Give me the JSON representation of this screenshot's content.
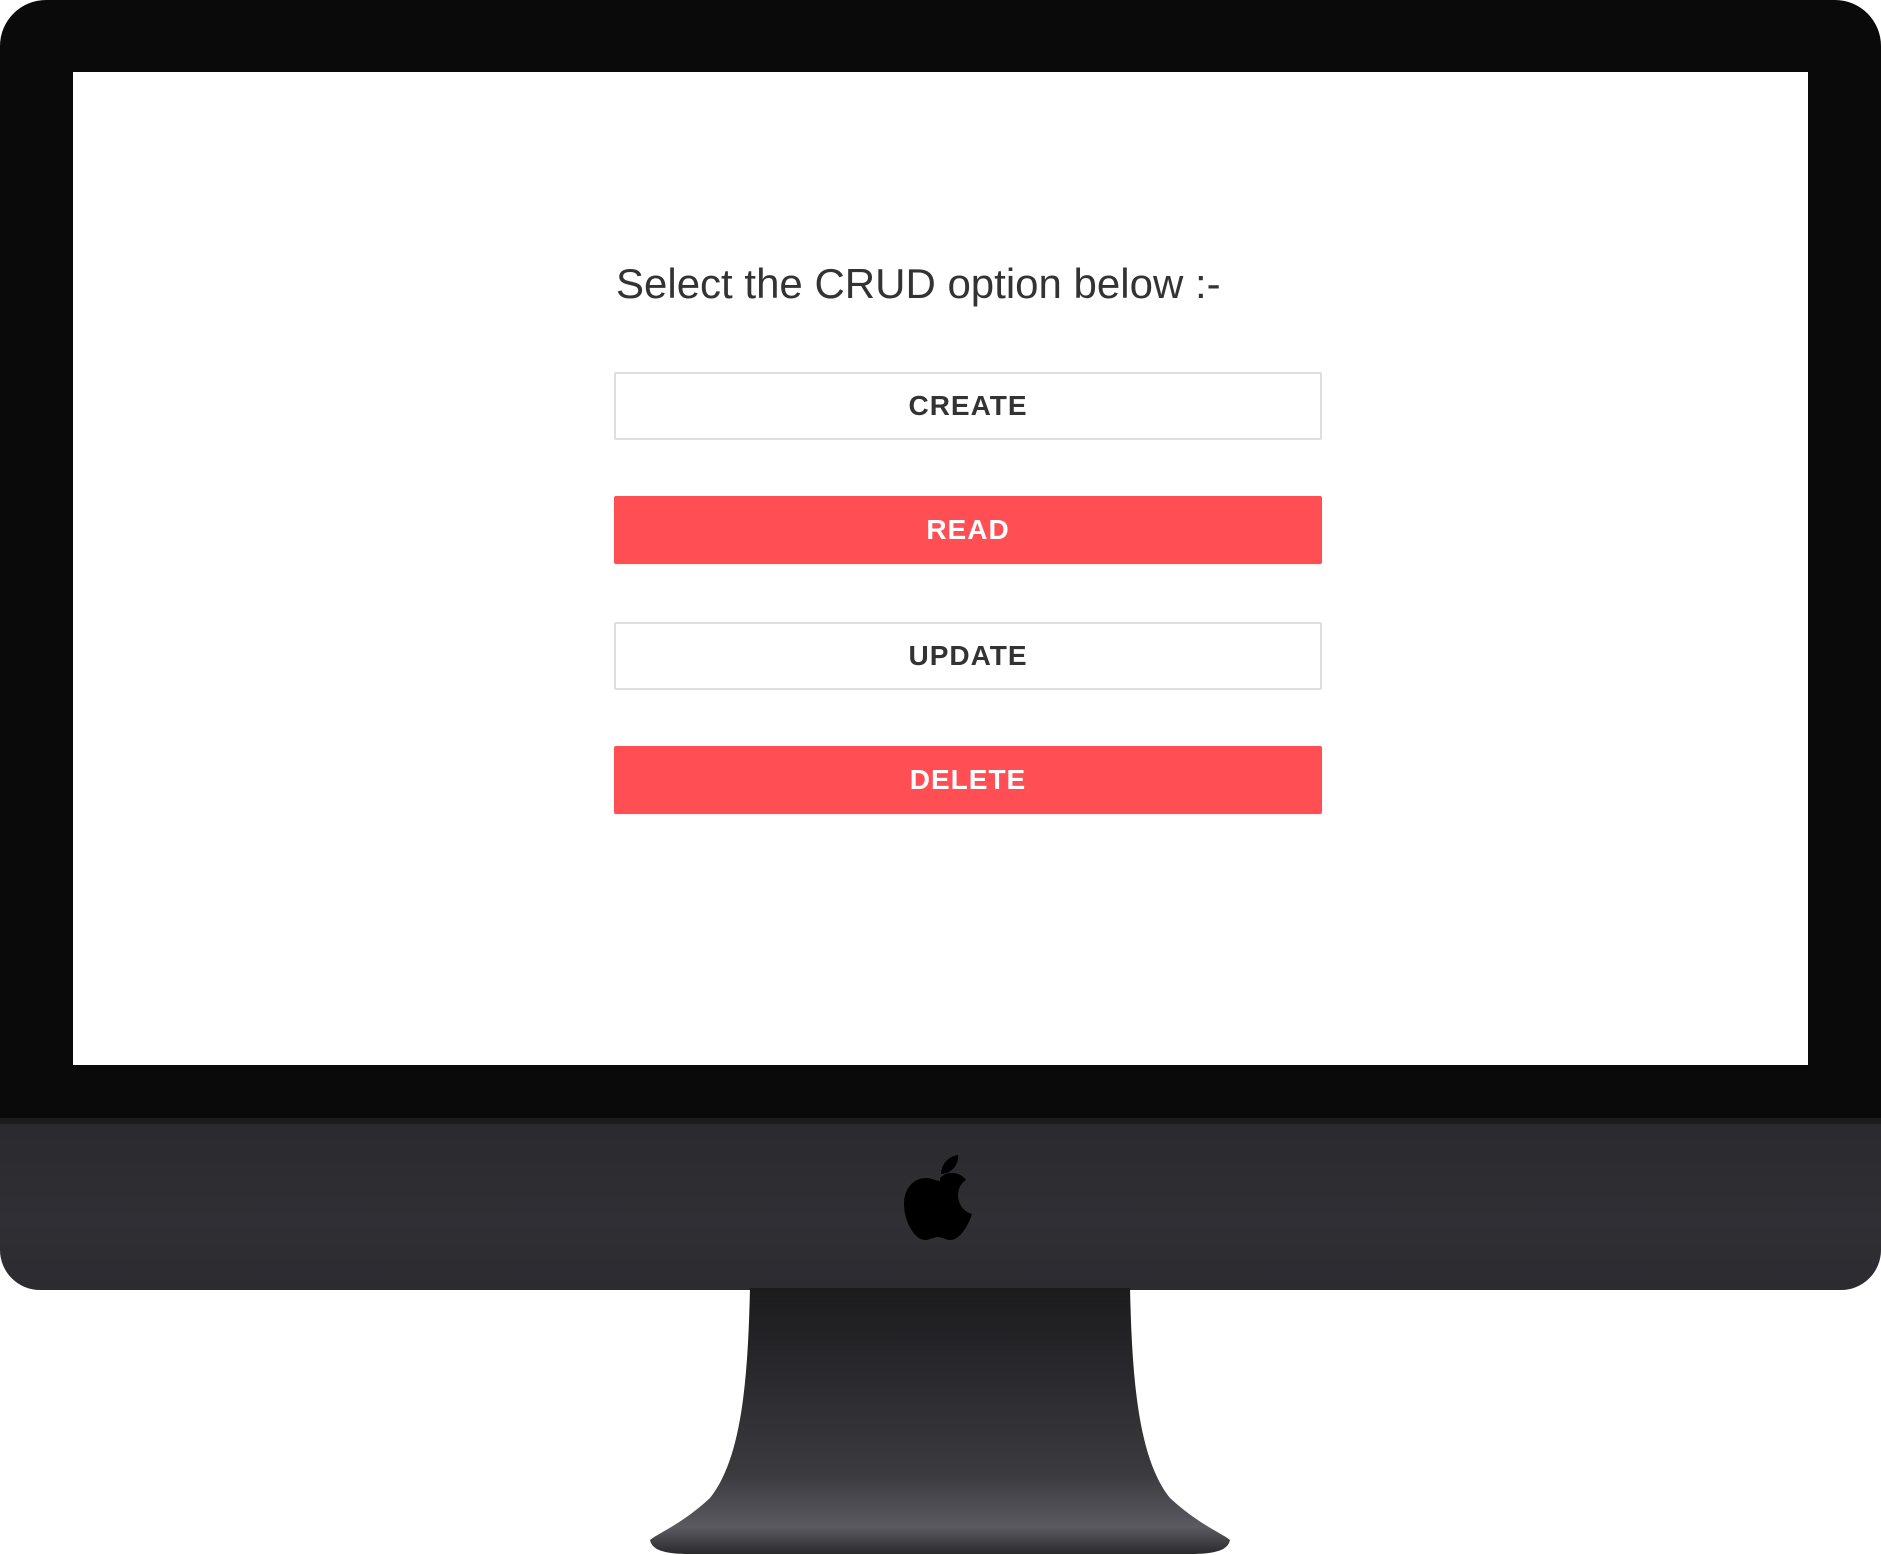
{
  "page": {
    "heading": "Select the CRUD option below :-"
  },
  "buttons": [
    {
      "label": "CREATE",
      "style": "outline"
    },
    {
      "label": "READ",
      "style": "filled"
    },
    {
      "label": "UPDATE",
      "style": "outline"
    },
    {
      "label": "DELETE",
      "style": "filled"
    }
  ],
  "colors": {
    "accent": "#ff4f55",
    "text": "#333333",
    "border": "#dedede",
    "bezel": "#0a0a0b",
    "chin": "#2e2e33"
  },
  "icons": {
    "brand": "apple-logo-icon"
  }
}
